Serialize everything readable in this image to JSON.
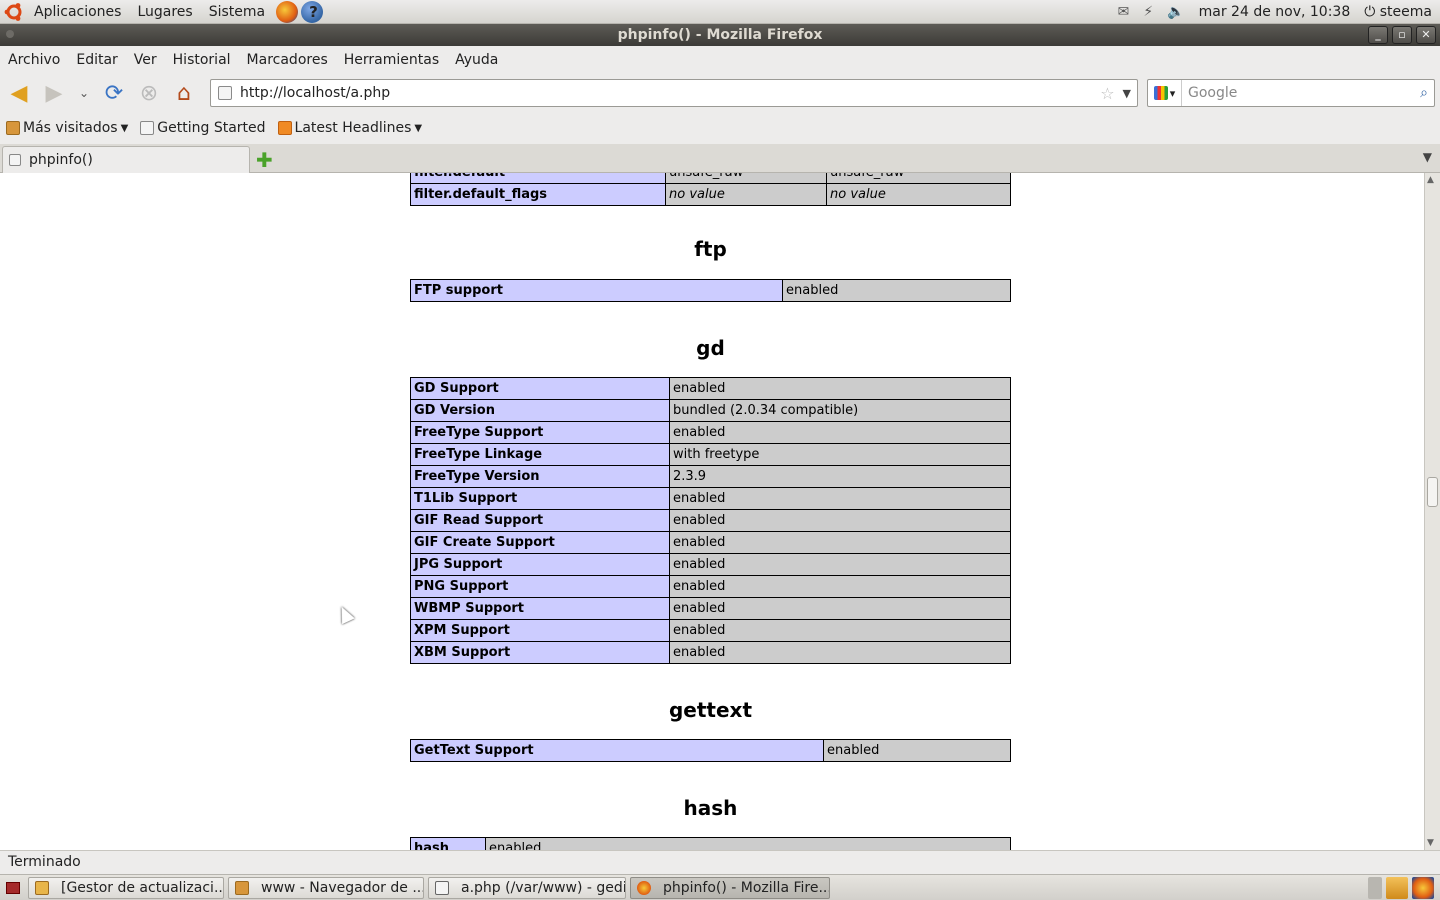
{
  "panel": {
    "menus": [
      "Aplicaciones",
      "Lugares",
      "Sistema"
    ],
    "datetime": "mar 24 de nov, 10:38",
    "user": "steema"
  },
  "window": {
    "title": "phpinfo() - Mozilla Firefox"
  },
  "menubar": [
    "Archivo",
    "Editar",
    "Ver",
    "Historial",
    "Marcadores",
    "Herramientas",
    "Ayuda"
  ],
  "navbar": {
    "url": "http://localhost/a.php",
    "search_placeholder": "Google"
  },
  "bookmarks": [
    "Más visitados",
    "Getting Started",
    "Latest Headlines"
  ],
  "tab": {
    "title": "phpinfo()"
  },
  "page": {
    "filter_partial": {
      "key": "filter.default",
      "v1": "unsafe_raw",
      "v2": "unsafe_raw"
    },
    "filter_row": {
      "key": "filter.default_flags",
      "v1": "no value",
      "v2": "no value"
    },
    "sections": {
      "ftp": {
        "title": "ftp",
        "rows": [
          [
            "FTP support",
            "enabled"
          ]
        ]
      },
      "gd": {
        "title": "gd",
        "rows": [
          [
            "GD Support",
            "enabled"
          ],
          [
            "GD Version",
            "bundled (2.0.34 compatible)"
          ],
          [
            "FreeType Support",
            "enabled"
          ],
          [
            "FreeType Linkage",
            "with freetype"
          ],
          [
            "FreeType Version",
            "2.3.9"
          ],
          [
            "T1Lib Support",
            "enabled"
          ],
          [
            "GIF Read Support",
            "enabled"
          ],
          [
            "GIF Create Support",
            "enabled"
          ],
          [
            "JPG Support",
            "enabled"
          ],
          [
            "PNG Support",
            "enabled"
          ],
          [
            "WBMP Support",
            "enabled"
          ],
          [
            "XPM Support",
            "enabled"
          ],
          [
            "XBM Support",
            "enabled"
          ]
        ]
      },
      "gettext": {
        "title": "gettext",
        "rows": [
          [
            "GetText Support",
            "enabled"
          ]
        ]
      },
      "hash": {
        "title": "hash",
        "rows": [
          [
            "hash",
            "enabled"
          ]
        ]
      }
    }
  },
  "status": "Terminado",
  "taskbar": [
    "[Gestor de actualizaci...",
    "www - Navegador de ...",
    "a.php (/var/www) - gedit",
    "phpinfo() - Mozilla Fire..."
  ]
}
